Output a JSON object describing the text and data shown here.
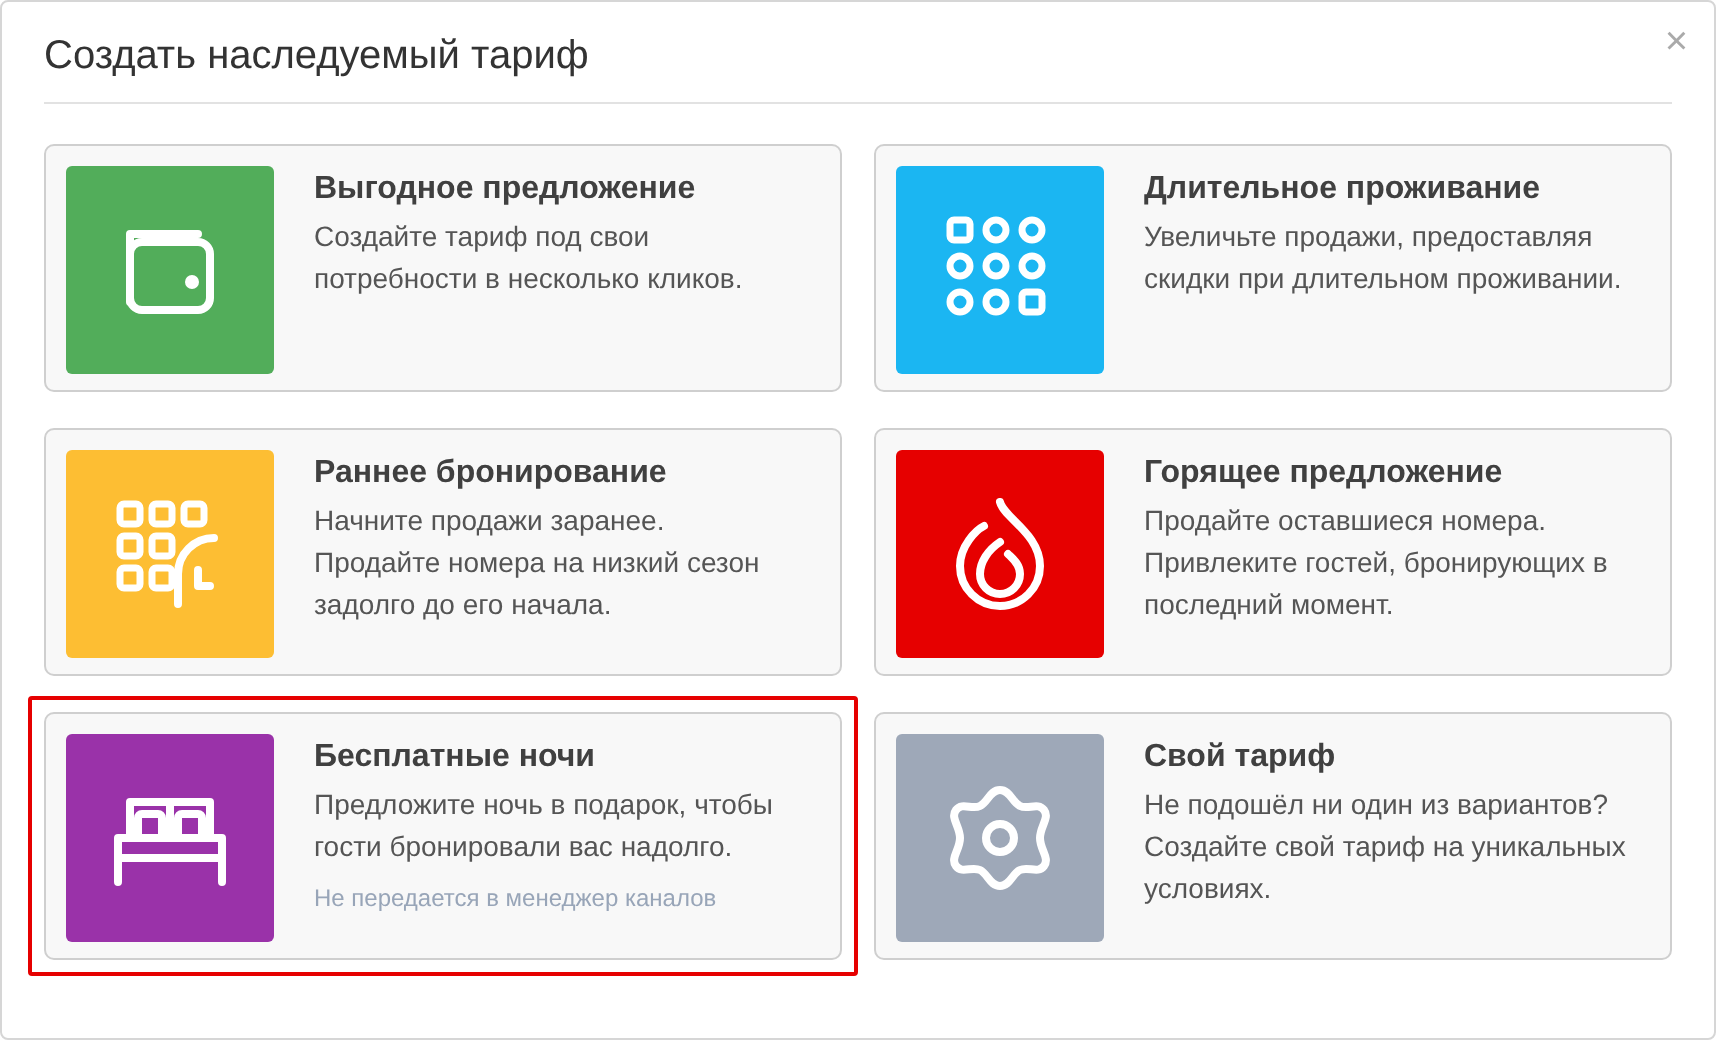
{
  "dialog": {
    "title": "Создать наследуемый тариф",
    "close": "×"
  },
  "cards": [
    {
      "kind": "wallet",
      "color": "#52ad5a",
      "title": "Выгодное предложение",
      "description": "Создайте тариф под свои потребности в несколько кликов.",
      "selected": false
    },
    {
      "kind": "dots",
      "color": "#1bb6f2",
      "title": "Длительное проживание",
      "description": "Увеличьте продажи, предоставляя скидки при длительном проживании.",
      "selected": false
    },
    {
      "kind": "calendar",
      "color": "#fdbe33",
      "title": "Раннее бронирование",
      "description": "Начните продажи заранее. Продайте номера на низкий сезон задолго до его начала.",
      "selected": false
    },
    {
      "kind": "flame",
      "color": "#e60000",
      "title": "Горящее предложение",
      "description": "Продайте оставшиеся номера. Привлеките гостей, бронирующих в последний момент.",
      "selected": false
    },
    {
      "kind": "bed",
      "color": "#9a32a9",
      "title": "Бесплатные ночи",
      "description": "Предложите ночь в подарок, чтобы гости бронировали вас надолго.",
      "note": "Не передается в менеджер каналов",
      "selected": true
    },
    {
      "kind": "gear",
      "color": "#9ea8b8",
      "title": "Свой тариф",
      "description": "Не подошёл ни один из вариантов? Создайте свой тариф на уникальных условиях.",
      "selected": false
    }
  ]
}
